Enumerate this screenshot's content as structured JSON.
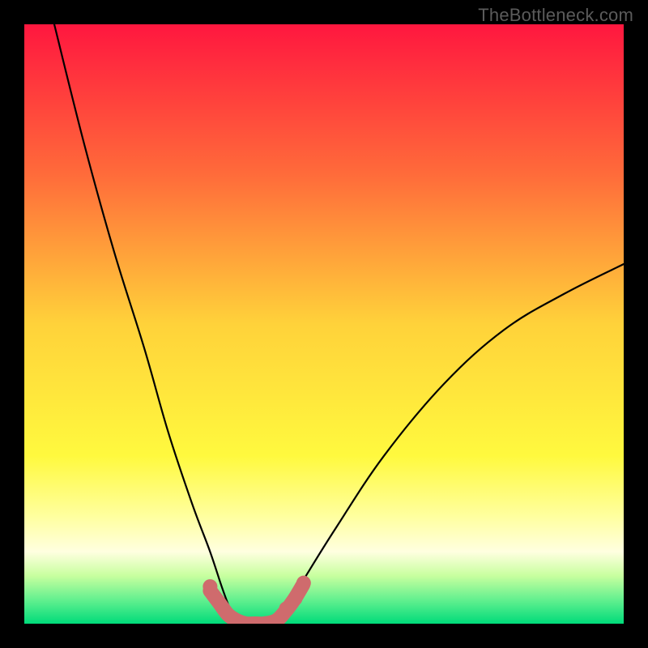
{
  "watermark": {
    "text": "TheBottleneck.com"
  },
  "chart_data": {
    "type": "line",
    "title": "",
    "xlabel": "",
    "ylabel": "",
    "xlim": [
      0,
      100
    ],
    "ylim": [
      0,
      100
    ],
    "grid": false,
    "legend": false,
    "gradient_stops": [
      {
        "offset": 0.0,
        "color": "#ff173f"
      },
      {
        "offset": 0.25,
        "color": "#ff6b3a"
      },
      {
        "offset": 0.5,
        "color": "#ffd23a"
      },
      {
        "offset": 0.72,
        "color": "#fff93e"
      },
      {
        "offset": 0.82,
        "color": "#ffff9e"
      },
      {
        "offset": 0.88,
        "color": "#ffffe0"
      },
      {
        "offset": 0.92,
        "color": "#c8ff9f"
      },
      {
        "offset": 0.96,
        "color": "#63f08f"
      },
      {
        "offset": 1.0,
        "color": "#00db7a"
      }
    ],
    "series": [
      {
        "name": "left-curve",
        "x": [
          5,
          10,
          15,
          20,
          24,
          28,
          31,
          33,
          34.5,
          35.5
        ],
        "y": [
          100,
          80,
          62,
          46,
          32,
          20,
          12,
          6,
          2,
          0
        ]
      },
      {
        "name": "right-curve",
        "x": [
          42,
          44,
          47,
          52,
          60,
          70,
          80,
          90,
          100
        ],
        "y": [
          0,
          3,
          8,
          16,
          28,
          40,
          49,
          55,
          60
        ]
      },
      {
        "name": "bottom-band",
        "x": [
          31,
          32.5,
          34,
          35.5,
          37,
          38.5,
          40,
          42,
          43.5,
          45,
          46.5
        ],
        "y": [
          5.5,
          3.5,
          1.5,
          0.5,
          0,
          0,
          0,
          0.5,
          2,
          4,
          6.5
        ]
      }
    ],
    "marker_points": {
      "x": [
        31,
        45.2,
        43.7,
        46.6
      ],
      "y": [
        6.2,
        4.2,
        2.5,
        6.8
      ]
    }
  }
}
